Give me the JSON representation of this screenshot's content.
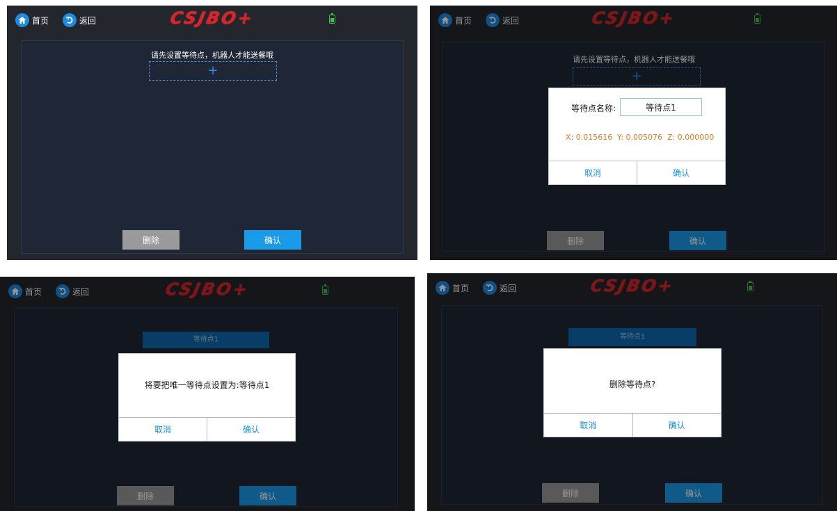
{
  "topbar": {
    "home_label": "首页",
    "back_label": "返回",
    "logo_text": "CSJBO+",
    "icons": {
      "home": "home-icon",
      "back": "back-icon",
      "battery": "battery-icon"
    }
  },
  "colors": {
    "accent": "#1a9bea",
    "logo": "#d7262a",
    "coords": "#e07a1c",
    "background": "#23262c",
    "delete_button": "#9a9a9a"
  },
  "panel1": {
    "prompt": "请先设置等待点，机器人才能送餐哦",
    "add_symbol": "+",
    "delete_label": "删除",
    "confirm_label": "确认"
  },
  "panel2": {
    "prompt": "请先设置等待点，机器人才能送餐哦",
    "add_symbol": "+",
    "dialog": {
      "field_label": "等待点名称:",
      "field_value": "等待点1",
      "x": "X: 0.015616",
      "y": "Y: 0.005076",
      "z": "Z: 0.000000",
      "cancel_label": "取消",
      "confirm_label": "确认"
    },
    "delete_label": "删除",
    "confirm_label": "确认"
  },
  "panel3": {
    "waypoint_label": "等待点1",
    "dialog": {
      "message": "将要把唯一等待点设置为:等待点1",
      "cancel_label": "取消",
      "confirm_label": "确认"
    },
    "delete_label": "删除",
    "confirm_label": "确认"
  },
  "panel4": {
    "waypoint_label": "等待点1",
    "dialog": {
      "message": "删除等待点?",
      "cancel_label": "取消",
      "confirm_label": "确认"
    },
    "delete_label": "删除",
    "confirm_label": "确认"
  }
}
